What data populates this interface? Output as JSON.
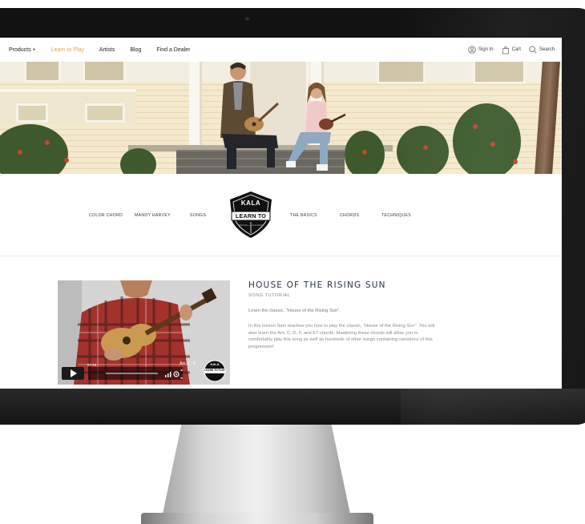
{
  "nav": {
    "items": [
      {
        "label": "Products +",
        "active": false
      },
      {
        "label": "Learn to Play",
        "active": true
      },
      {
        "label": "Artists",
        "active": false
      },
      {
        "label": "Blog",
        "active": false
      },
      {
        "label": "Find a Dealer",
        "active": false
      }
    ],
    "sign_in": "Sign In",
    "cart": "Cart",
    "search": "Search"
  },
  "categories": {
    "left": [
      "COLOR CHORD",
      "MANDY HARVEY",
      "SONGS"
    ],
    "right": [
      "THE BASICS",
      "CHORDS",
      "TECHNIQUES"
    ]
  },
  "badge": {
    "brand": "KALA",
    "text": "LEARN TO PLAY"
  },
  "video": {
    "time": "07:23",
    "chords": "Am  C  D",
    "badge_brand": "KALA",
    "badge_text": "LEARN TO PLAY"
  },
  "song": {
    "title": "HOUSE OF THE RISING SUN",
    "subtitle": "SONG TUTORIAL",
    "lead": "Learn the classic, \"House of the Rising Sun\".",
    "description": "In this lesson Sam teaches you how to play the classic, \"House of the Rising Sun\". You will also learn the Am, C, D, F, and E7 chords. Mastering these chords will allow you to comfortably play this song as well as hundreds of other songs containing variations of this progression!"
  },
  "colors": {
    "accent": "#d9a35a",
    "nav_text": "#222222",
    "category_text": "#2c3e55",
    "title_text": "#2a3545",
    "bezel": "#121212"
  },
  "icons": [
    "user-icon",
    "bag-icon",
    "search-icon",
    "play-icon",
    "volume-icon",
    "gear-icon",
    "fullscreen-icon"
  ]
}
